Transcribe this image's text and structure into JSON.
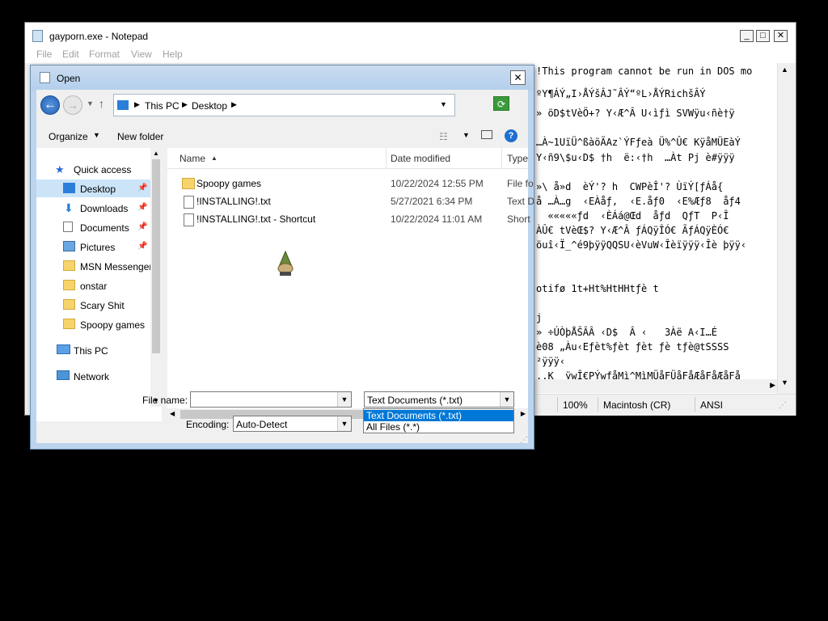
{
  "notepad": {
    "title": "gayporn.exe - Notepad",
    "menu": [
      "File",
      "Edit",
      "Format",
      "View",
      "Help"
    ],
    "text_lines": [
      "!This program cannot be run in DOS mo",
      "ºY¶ÁÝ„I›ÅÝšÂJ˜ÂÝ“ºL›ÅÝRichšÂÝ",
      "» öD$tVèÖ+? Y‹Æ^Â U‹ìƒì SVWÿu‹ñè†ÿ",
      "",
      "…À~1UïÜ^ßàöÄAz`ÝFƒeà Ü%^Û€ KÿåMÜEàÝ",
      "Y‹ñ9\\$u‹D$ †h  ë:‹†h  …Àt Pj è#ÿÿÿ",
      "",
      "»\\ å»d  èÝ'? h  CWPèÎ'? ÙïÝ[ƒÁå{",
      "å …À…g  ‹EÀåƒ,  ‹E.åƒ0  ‹E%Æƒ8  åƒ4",
      "  «««««ƒd  ‹ÈÁá@Œd  åƒd  QƒT  P‹Î",
      "ÀÛ€ tVèŒ$? Y‹Æ^Â ƒÁQÿÎÓ€ ÃƒÁQÿÈÓ€",
      "öuî‹Ï_^é9þÿÿQQSU‹èVuW‹Îèïÿÿÿ‹Îè þÿÿ‹",
      "",
      "",
      "otifø 1t+Ht%HtHHtƒè t",
      "",
      "j",
      "» ÷ÚÒþÅŠÂÂ ‹D$  Â ‹   3Àë A‹I…É",
      "è08 „Àu‹Eƒèt%ƒèt ƒèt ƒè tƒè@tSSSS",
      "²ÿÿÿ‹",
      "..K  ÿwÎ€PÝwƒåMì^MìMÜåFÜåFåÆåFåÆåFå"
    ],
    "status": {
      "zoom": "100%",
      "line_ending": "Macintosh (CR)",
      "encoding": "ANSI"
    }
  },
  "dialog": {
    "title": "Open",
    "breadcrumb": [
      "This PC",
      "Desktop"
    ],
    "toolbar": {
      "organize": "Organize",
      "new_folder": "New folder"
    },
    "nav_items": [
      {
        "label": "Quick access",
        "icon": "star-icon",
        "pinned": false
      },
      {
        "label": "Desktop",
        "icon": "desktop-icon",
        "pinned": true,
        "selected": true
      },
      {
        "label": "Downloads",
        "icon": "download-icon",
        "pinned": true
      },
      {
        "label": "Documents",
        "icon": "documents-icon",
        "pinned": true
      },
      {
        "label": "Pictures",
        "icon": "pictures-icon",
        "pinned": true
      },
      {
        "label": "MSN Messenger",
        "icon": "folder-icon",
        "pinned": false
      },
      {
        "label": "onstar",
        "icon": "folder-icon",
        "pinned": false
      },
      {
        "label": "Scary Shit",
        "icon": "folder-icon",
        "pinned": false
      },
      {
        "label": "Spoopy games",
        "icon": "folder-icon",
        "pinned": false
      },
      {
        "label": "This PC",
        "icon": "computer-icon",
        "pinned": false
      },
      {
        "label": "Network",
        "icon": "network-icon",
        "pinned": false
      }
    ],
    "columns": [
      "Name",
      "Date modified",
      "Type"
    ],
    "files": [
      {
        "name": "Spoopy games",
        "date": "10/22/2024 12:55 PM",
        "type": "File fo",
        "icon": "folder-icon"
      },
      {
        "name": "!INSTALLING!.txt",
        "date": "5/27/2021 6:34 PM",
        "type": "Text D",
        "icon": "text-file-icon"
      },
      {
        "name": "!INSTALLING!.txt - Shortcut",
        "date": "10/22/2024 11:01 AM",
        "type": "Short",
        "icon": "shortcut-icon"
      }
    ],
    "file_name_label": "File name:",
    "file_name_value": "",
    "encoding_label": "Encoding:",
    "encoding_value": "Auto-Detect",
    "file_type_value": "Text Documents (*.txt)",
    "file_type_options": [
      "Text Documents (*.txt)",
      "All Files  (*.*)"
    ]
  }
}
